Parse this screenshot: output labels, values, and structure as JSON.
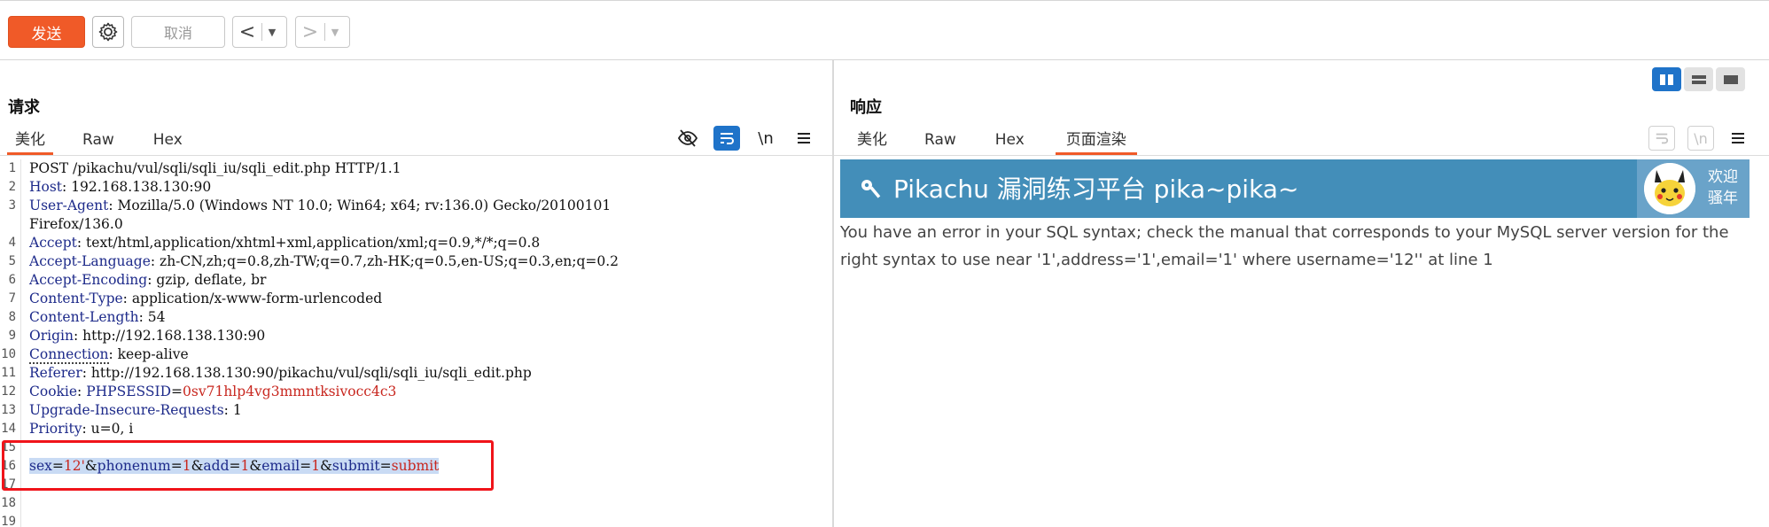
{
  "toolbar": {
    "send_label": "发送",
    "cancel_label": "取消",
    "back_icon": "chevron-left-icon",
    "forward_icon": "chevron-right-icon",
    "settings_icon": "gear-icon"
  },
  "request": {
    "title": "请求",
    "tabs": [
      "美化",
      "Raw",
      "Hex"
    ],
    "active_tab": "美化",
    "tool_icons": [
      "eye-off-icon",
      "wrap-lines-icon",
      "newline-icon",
      "menu-icon"
    ],
    "newline_label": "\\n",
    "lines": [
      {
        "n": "1",
        "parts": [
          {
            "t": "POST /pikachu/vul/sqli/sqli_iu/sqli_edit.php HTTP/1.1",
            "c": "v"
          }
        ]
      },
      {
        "n": "2",
        "parts": [
          {
            "t": "Host",
            "c": "k"
          },
          {
            "t": ": 192.168.138.130:90",
            "c": "v"
          }
        ]
      },
      {
        "n": "3",
        "parts": [
          {
            "t": "User-Agent",
            "c": "k"
          },
          {
            "t": ": Mozilla/5.0 (Windows NT 10.0; Win64; x64; rv:136.0) Gecko/20100101",
            "c": "v"
          }
        ]
      },
      {
        "n": "",
        "parts": [
          {
            "t": "Firefox/136.0",
            "c": "v"
          }
        ]
      },
      {
        "n": "4",
        "parts": [
          {
            "t": "Accept",
            "c": "k"
          },
          {
            "t": ": text/html,application/xhtml+xml,application/xml;q=0.9,*/*;q=0.8",
            "c": "v"
          }
        ]
      },
      {
        "n": "5",
        "parts": [
          {
            "t": "Accept-Language",
            "c": "k"
          },
          {
            "t": ": zh-CN,zh;q=0.8,zh-TW;q=0.7,zh-HK;q=0.5,en-US;q=0.3,en;q=0.2",
            "c": "v"
          }
        ]
      },
      {
        "n": "6",
        "parts": [
          {
            "t": "Accept-Encoding",
            "c": "k"
          },
          {
            "t": ": gzip, deflate, br",
            "c": "v"
          }
        ]
      },
      {
        "n": "7",
        "parts": [
          {
            "t": "Content-Type",
            "c": "k"
          },
          {
            "t": ": application/x-www-form-urlencoded",
            "c": "v"
          }
        ]
      },
      {
        "n": "8",
        "parts": [
          {
            "t": "Content-Length",
            "c": "k"
          },
          {
            "t": ": 54",
            "c": "v"
          }
        ]
      },
      {
        "n": "9",
        "parts": [
          {
            "t": "Origin",
            "c": "k"
          },
          {
            "t": ": http://192.168.138.130:90",
            "c": "v"
          }
        ]
      },
      {
        "n": "10",
        "parts": [
          {
            "t": "Connection",
            "c": "k"
          },
          {
            "t": ": keep-alive",
            "c": "v"
          }
        ]
      },
      {
        "n": "11",
        "parts": [
          {
            "t": "Referer",
            "c": "k"
          },
          {
            "t": ": http://192.168.138.130:90/pikachu/vul/sqli/sqli_iu/sqli_edit.php",
            "c": "v"
          }
        ]
      },
      {
        "n": "12",
        "parts": [
          {
            "t": "Cookie",
            "c": "k"
          },
          {
            "t": ": ",
            "c": "v"
          },
          {
            "t": "PHPSESSID",
            "c": "k"
          },
          {
            "t": "=",
            "c": "v"
          },
          {
            "t": "0sv71hlp4vg3mmntksivocc4c3",
            "c": "r"
          }
        ]
      },
      {
        "n": "13",
        "parts": [
          {
            "t": "Upgrade-Insecure-Requests",
            "c": "k"
          },
          {
            "t": ": 1",
            "c": "v"
          }
        ]
      },
      {
        "n": "14",
        "parts": [
          {
            "t": "Priority",
            "c": "k"
          },
          {
            "t": ": u=0, i",
            "c": "v"
          }
        ]
      },
      {
        "n": "15",
        "parts": []
      },
      {
        "n": "16",
        "parts": [
          {
            "t": "sex",
            "c": "k sel"
          },
          {
            "t": "=",
            "c": "v sel"
          },
          {
            "t": "12'",
            "c": "r sel"
          },
          {
            "t": "&",
            "c": "v sel"
          },
          {
            "t": "phonenum",
            "c": "k sel"
          },
          {
            "t": "=",
            "c": "v sel"
          },
          {
            "t": "1",
            "c": "r sel"
          },
          {
            "t": "&",
            "c": "v sel"
          },
          {
            "t": "add",
            "c": "k sel"
          },
          {
            "t": "=",
            "c": "v sel"
          },
          {
            "t": "1",
            "c": "r sel"
          },
          {
            "t": "&",
            "c": "v sel"
          },
          {
            "t": "email",
            "c": "k sel"
          },
          {
            "t": "=",
            "c": "v sel"
          },
          {
            "t": "1",
            "c": "r sel"
          },
          {
            "t": "&",
            "c": "v sel"
          },
          {
            "t": "submit",
            "c": "k sel"
          },
          {
            "t": "=",
            "c": "v sel"
          },
          {
            "t": "submit",
            "c": "r sel"
          }
        ]
      },
      {
        "n": "17",
        "parts": []
      },
      {
        "n": "18",
        "parts": []
      },
      {
        "n": "19",
        "parts": []
      }
    ]
  },
  "response": {
    "title": "响应",
    "tabs": [
      "美化",
      "Raw",
      "Hex",
      "页面渲染"
    ],
    "active_tab": "页面渲染",
    "tool_icons": [
      "wrap-lines-icon",
      "newline-icon",
      "menu-icon"
    ],
    "newline_label": "\\n",
    "render": {
      "site_title": "Pikachu 漏洞练习平台 pika~pika~",
      "welcome_line1": "欢迎",
      "welcome_line2": "骚年",
      "error_message": "You have an error in your SQL syntax; check the manual that corresponds to your MySQL server version for the right syntax to use near '1',address='1',email='1' where username='12'' at line 1"
    }
  },
  "layout_modes": [
    "split-columns-icon",
    "split-rows-icon",
    "single-pane-icon"
  ],
  "colors": {
    "accent": "#f05a28",
    "selected": "#1f73c9",
    "banner": "#438eb9",
    "highlight_box": "#f0141a"
  }
}
